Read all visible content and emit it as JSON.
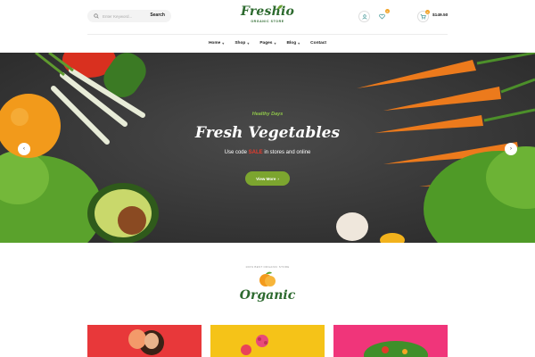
{
  "header": {
    "search_placeholder": "Enter Keyword...",
    "search_button": "Search",
    "logo_title": "Freshio",
    "logo_subtitle": "ORGANIC STORE",
    "wishlist_count": "0",
    "cart_count": "0",
    "cart_total": "$149.50"
  },
  "nav": {
    "items": [
      {
        "label": "Home",
        "has_dropdown": true
      },
      {
        "label": "Shop",
        "has_dropdown": true
      },
      {
        "label": "Pages",
        "has_dropdown": true
      },
      {
        "label": "Blog",
        "has_dropdown": true
      },
      {
        "label": "Contact",
        "has_dropdown": false
      }
    ]
  },
  "hero": {
    "eyebrow": "Healthy Days",
    "title": "Fresh Vegetables",
    "subtitle_prefix": "Use code",
    "promo_code": "SALE",
    "subtitle_suffix": "in stores and online",
    "button_label": "View More",
    "button_icon": "chevron-right-icon",
    "prev_icon": "chevron-left-icon",
    "next_icon": "chevron-right-icon"
  },
  "organic": {
    "arc_text": "100% BEST ORGANIC STORE",
    "title": "Organic"
  },
  "cards": [
    {
      "name": "card-red",
      "color": "#e8383a"
    },
    {
      "name": "card-yellow",
      "color": "#f5c318"
    },
    {
      "name": "card-pink",
      "color": "#f0357a"
    }
  ],
  "colors": {
    "brand_green": "#2d6a2f",
    "accent_green": "#7ca52f",
    "badge_orange": "#f1a42a",
    "promo_red": "#e63b2e"
  }
}
